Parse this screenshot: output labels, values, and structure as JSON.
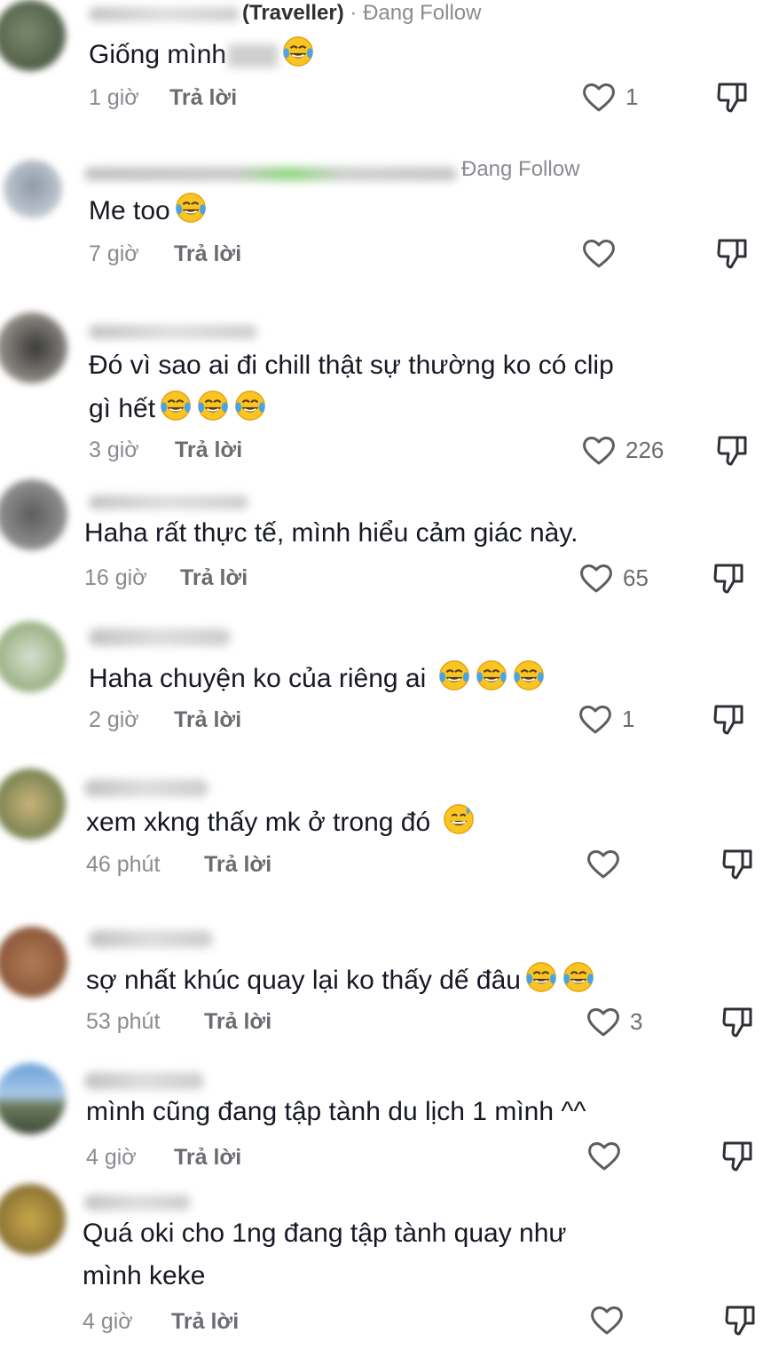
{
  "comments": [
    {
      "name_suffix": "(Traveller)",
      "follow_label": "· Đang Follow",
      "text": "Giống mình",
      "emoji_count": 1,
      "time": "1 giờ",
      "reply": "Trả lời",
      "likes": "1"
    },
    {
      "name_suffix": "",
      "follow_label": "Đang Follow",
      "text": "Me too",
      "emoji_count": 1,
      "time": "7 giờ",
      "reply": "Trả lời",
      "likes": ""
    },
    {
      "name_suffix": "",
      "follow_label": "",
      "text": "Đó vì sao ai đi chill thật sự thường ko có clip",
      "text_line2": "gì hết",
      "emoji_count": 3,
      "time": "3 giờ",
      "reply": "Trả lời",
      "likes": "226"
    },
    {
      "name_suffix": "",
      "follow_label": "",
      "text": "Haha rất thực tế, mình hiểu cảm giác này.",
      "emoji_count": 0,
      "time": "16 giờ",
      "reply": "Trả lời",
      "likes": "65"
    },
    {
      "name_suffix": "",
      "follow_label": "",
      "text": "Haha chuyện ko của riêng ai",
      "emoji_count": 3,
      "time": "2 giờ",
      "reply": "Trả lời",
      "likes": "1"
    },
    {
      "name_suffix": "",
      "follow_label": "",
      "text": "xem xkng thấy mk ở trong đó",
      "emoji_count": 1,
      "time": "46 phút",
      "reply": "Trả lời",
      "likes": ""
    },
    {
      "name_suffix": "",
      "follow_label": "",
      "text": "sợ nhất khúc quay lại ko thấy dế đâu",
      "emoji_count": 2,
      "time": "53 phút",
      "reply": "Trả lời",
      "likes": "3"
    },
    {
      "name_suffix": "",
      "follow_label": "",
      "text": "mình cũng đang tập tành du lịch 1 mình ^^",
      "emoji_count": 0,
      "time": "4 giờ",
      "reply": "Trả lời",
      "likes": ""
    },
    {
      "name_suffix": "",
      "follow_label": "",
      "text": "Quá oki cho 1ng đang tập tành quay như",
      "text_line2": "mình keke",
      "emoji_count": 0,
      "time": "4 giờ",
      "reply": "Trả lời",
      "likes": ""
    }
  ],
  "icons": {
    "like": "heart-outline-icon",
    "dislike": "thumbs-down-icon",
    "emoji": "laughing-tears-emoji"
  }
}
